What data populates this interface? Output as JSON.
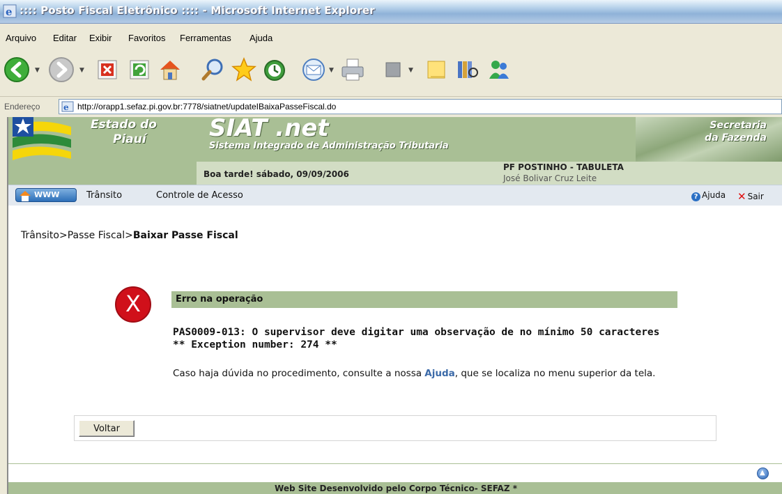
{
  "window": {
    "title": ":::: Posto Fiscal Eletrônico :::: - Microsoft Internet Explorer"
  },
  "menu": {
    "items": [
      "Arquivo",
      "Editar",
      "Exibir",
      "Favoritos",
      "Ferramentas",
      "Ajuda"
    ]
  },
  "toolbar": {
    "icons": [
      "back-icon",
      "forward-icon",
      "stop-icon",
      "refresh-icon",
      "home-icon",
      "search-icon",
      "favorites-icon",
      "history-icon",
      "mail-icon",
      "print-icon",
      "edit-icon",
      "notes-icon",
      "research-icon",
      "messenger-icon"
    ]
  },
  "address": {
    "label": "Endereço",
    "url": "http://orapp1.sefaz.pi.gov.br:7778/siatnet/updateIBaixaPasseFiscal.do"
  },
  "site": {
    "state_line1": "Estado do",
    "state_line2": "Piauí",
    "brand": "SIAT .net",
    "brand_sub": "Sistema Integrado de Administração Tributaria",
    "sefaz_line1": "Secretaria",
    "sefaz_line2": "da Fazenda",
    "greeting": "Boa tarde! sábado, 09/09/2006",
    "unit": "PF POSTINHO - TABULETA",
    "user": "José Bolivar Cruz Leite"
  },
  "nav": {
    "www": "WWW",
    "item1": "Trânsito",
    "item2": "Controle de Acesso",
    "help": "Ajuda",
    "exit": "Sair"
  },
  "breadcrumb": {
    "part1": "Trânsito",
    "sep": ">",
    "part2": "Passe Fiscal",
    "current": "Baixar Passe Fiscal"
  },
  "error": {
    "title": "Erro na operação",
    "message": "PAS0009-013: O supervisor deve digitar uma observação de no mínimo 50 caracteres ** Exception number: 274 **",
    "help_before": "Caso haja dúvida no procedimento, consulte a nossa ",
    "help_link": "Ajuda",
    "help_after": ", que se localiza no menu superior da tela."
  },
  "buttons": {
    "back": "Voltar"
  },
  "footer": {
    "text": "Web Site Desenvolvido pelo Corpo Técnico- SEFAZ *"
  }
}
